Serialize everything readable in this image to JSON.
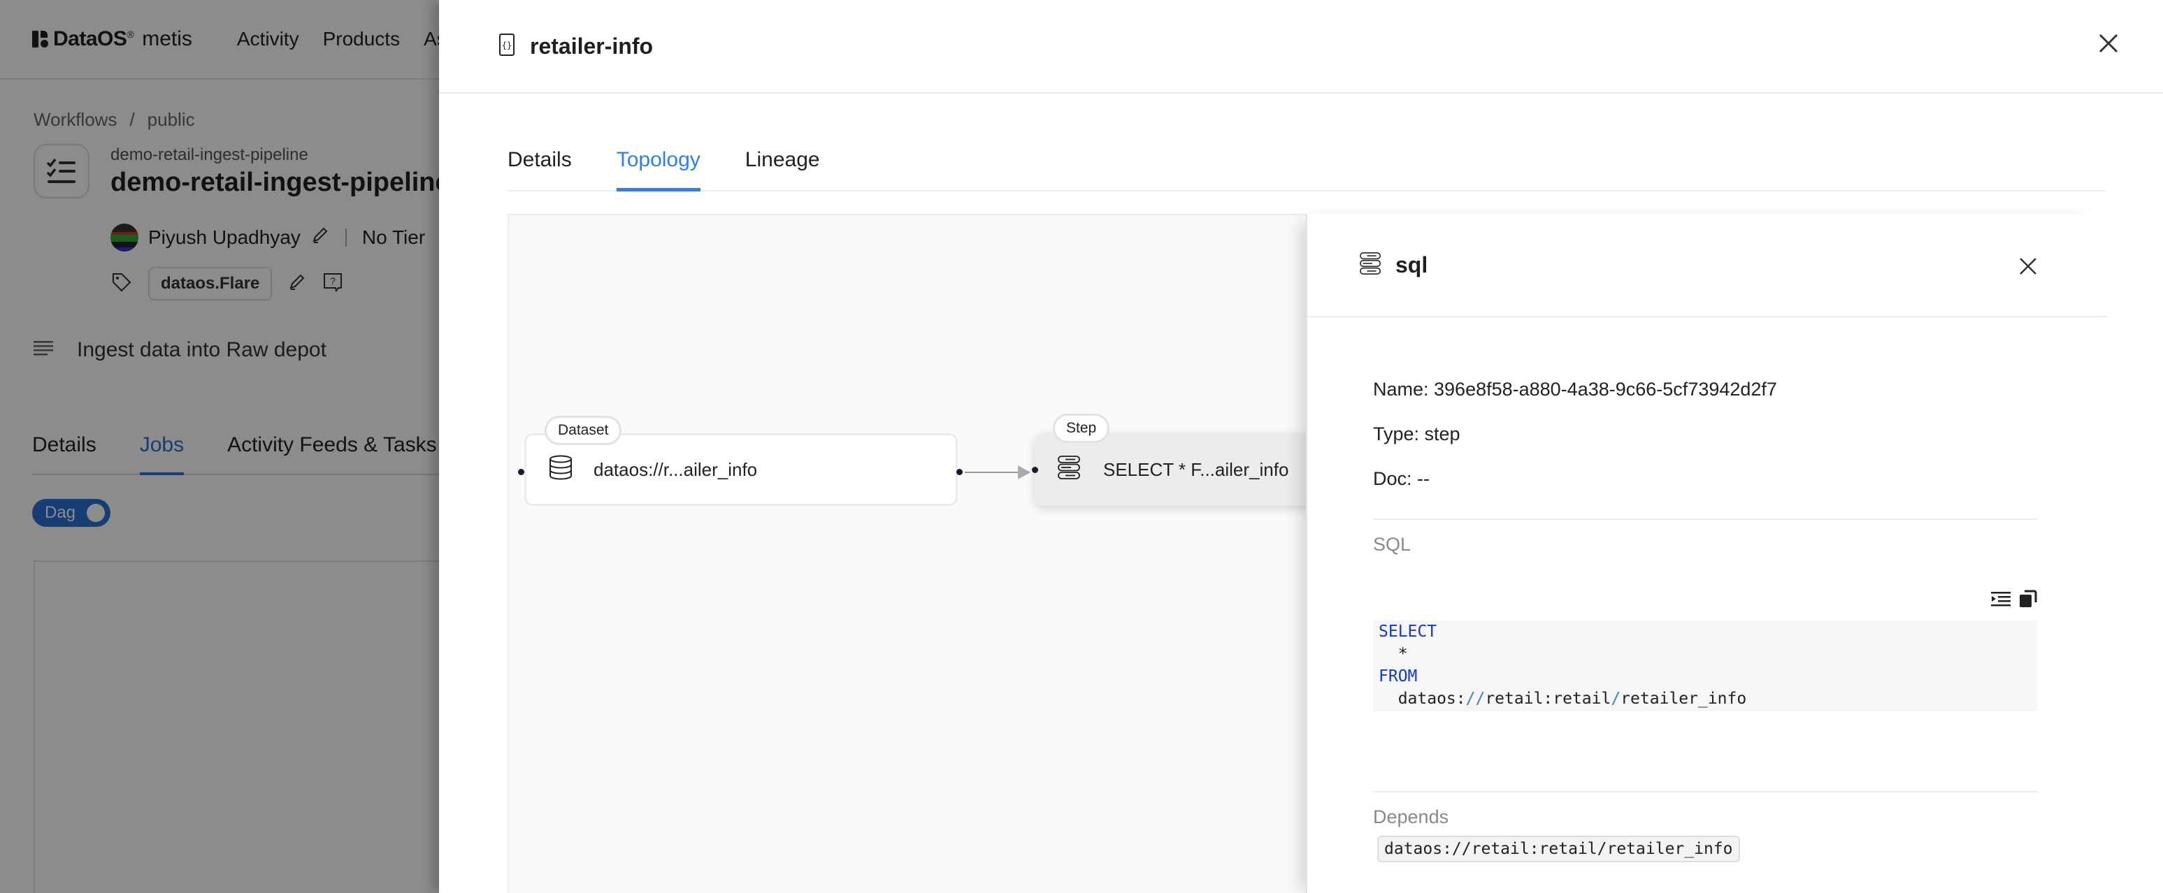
{
  "app": {
    "brand": "DataOS",
    "brand_mark": "®",
    "product": "metis",
    "nav": [
      "Activity",
      "Products",
      "Ass"
    ]
  },
  "page": {
    "breadcrumb": [
      "Workflows",
      "/",
      "public"
    ],
    "workflow_subtitle": "demo-retail-ingest-pipeline",
    "workflow_title": "demo-retail-ingest-pipeline",
    "owner": "Piyush Upadhyay",
    "tier": "No Tier",
    "tag": "dataos.Flare",
    "description": "Ingest data into Raw depot",
    "tabs": [
      {
        "label": "Details",
        "active": false
      },
      {
        "label": "Jobs",
        "active": true
      },
      {
        "label": "Activity Feeds & Tasks",
        "active": false
      }
    ],
    "dag_toggle": {
      "label": "Dag",
      "on": true
    }
  },
  "modal": {
    "title": "retailer-info",
    "tabs": [
      {
        "label": "Details",
        "active": false
      },
      {
        "label": "Topology",
        "active": true
      },
      {
        "label": "Lineage",
        "active": false
      }
    ],
    "topology": {
      "nodes": [
        {
          "badge": "Dataset",
          "label": "dataos://r...ailer_info",
          "icon": "database-icon"
        },
        {
          "badge": "Step",
          "label": "SELECT * F...ailer_info",
          "icon": "sql-step-icon"
        }
      ]
    },
    "side_panel": {
      "title": "sql",
      "name_line": "Name: 396e8f58-a880-4a38-9c66-5cf73942d2f7",
      "type_line": "Type: step",
      "doc_line": "Doc: --",
      "sql_label": "SQL",
      "sql": {
        "kw_select": "SELECT",
        "star": "  *",
        "kw_from": "FROM",
        "source_prefix": "  dataos:",
        "source_slashes": "//",
        "source_mid": "retail:retail",
        "source_slash2": "/",
        "source_table": "retailer_info"
      },
      "depends_label": "Depends",
      "depends": [
        "dataos://retail:retail/retailer_info"
      ]
    }
  },
  "colors": {
    "accent": "#2b80f0",
    "sql_keyword": "#1538c9",
    "overlay": "rgba(0,0,0,0.45)"
  }
}
